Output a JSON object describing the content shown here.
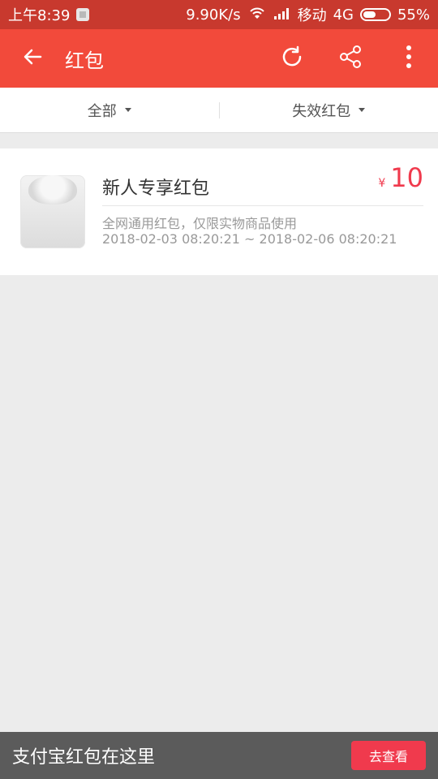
{
  "status_bar": {
    "time": "上午8:39",
    "network_speed": "9.90K/s",
    "carrier": "移动",
    "network_type": "4G",
    "battery_percent": "55%",
    "battery_level": 0.55
  },
  "app_bar": {
    "title": "红包",
    "icons": {
      "back": "back-arrow-icon",
      "refresh": "refresh-icon",
      "share": "share-icon",
      "more": "more-vertical-icon"
    }
  },
  "filters": {
    "left_label": "全部",
    "right_label": "失效红包"
  },
  "red_packet_card": {
    "title": "新人专享红包",
    "currency": "¥",
    "amount": "10",
    "description": "全网通用红包，仅限实物商品使用",
    "validity": "2018-02-03 08:20:21 ~ 2018-02-06 08:20:21"
  },
  "bottom_bar": {
    "message": "支付宝红包在这里",
    "button_label": "去查看"
  },
  "colors": {
    "primary": "#f24a3b",
    "status_bar": "#c8392e",
    "accent": "#f03a4d",
    "bottom_bar": "#5b5b5b",
    "background": "#ececec"
  }
}
